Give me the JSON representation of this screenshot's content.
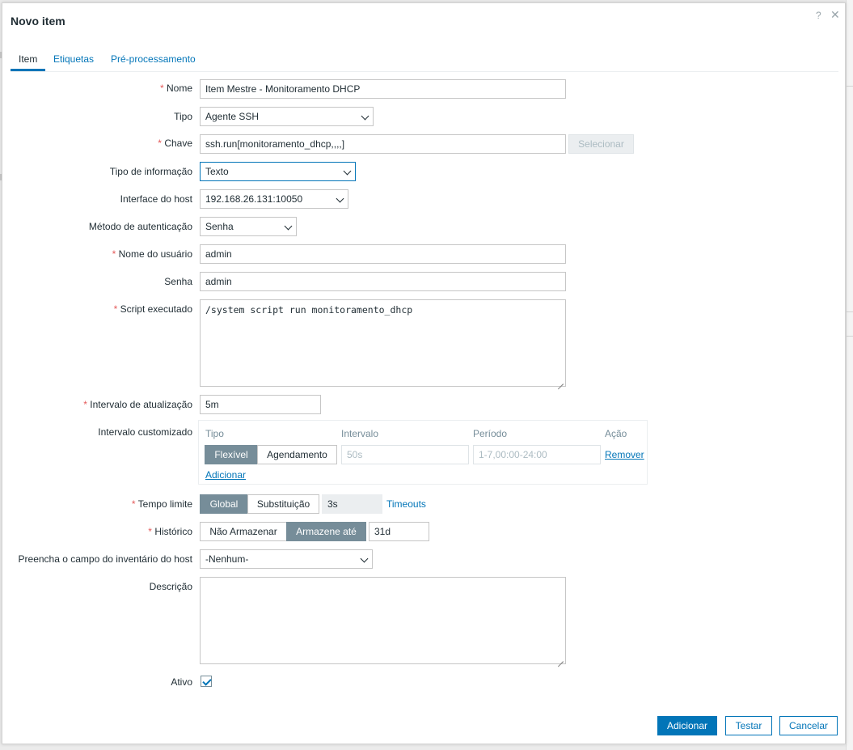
{
  "dialog": {
    "title": "Novo item",
    "help_icon": "?",
    "close_icon": "✕"
  },
  "tabs": [
    {
      "label": "Item",
      "active": true
    },
    {
      "label": "Etiquetas",
      "active": false
    },
    {
      "label": "Pré-processamento",
      "active": false
    }
  ],
  "required_mark": "*",
  "form": {
    "name": {
      "label": "Nome",
      "value": "Item Mestre - Monitoramento DHCP"
    },
    "type": {
      "label": "Tipo",
      "value": "Agente SSH"
    },
    "key": {
      "label": "Chave",
      "value": "ssh.run[monitoramento_dhcp,,,,]",
      "select_button": "Selecionar"
    },
    "info_type": {
      "label": "Tipo de informação",
      "value": "Texto"
    },
    "host_interface": {
      "label": "Interface do host",
      "value": "192.168.26.131:10050"
    },
    "auth_method": {
      "label": "Método de autenticação",
      "value": "Senha"
    },
    "username": {
      "label": "Nome do usuário",
      "value": "admin"
    },
    "password": {
      "label": "Senha",
      "value": "admin"
    },
    "script": {
      "label": "Script executado",
      "value": "/system script run monitoramento_dhcp"
    },
    "update_interval": {
      "label": "Intervalo de atualização",
      "value": "5m"
    },
    "custom_intervals": {
      "label": "Intervalo customizado",
      "columns": [
        "Tipo",
        "Intervalo",
        "Período",
        "Ação"
      ],
      "row": {
        "type_options": [
          "Flexível",
          "Agendamento"
        ],
        "selected_type": "Flexível",
        "interval_placeholder": "50s",
        "period_placeholder": "1-7,00:00-24:00",
        "remove_label": "Remover"
      },
      "add_label": "Adicionar"
    },
    "timeout": {
      "label": "Tempo limite",
      "options": [
        "Global",
        "Substituição"
      ],
      "selected": "Global",
      "value": "3s",
      "link": "Timeouts"
    },
    "history": {
      "label": "Histórico",
      "options": [
        "Não Armazenar",
        "Armazene até"
      ],
      "selected": "Armazene até",
      "value": "31d"
    },
    "inventory": {
      "label": "Preencha o campo do inventário do host",
      "value": "-Nenhum-"
    },
    "description": {
      "label": "Descrição",
      "value": ""
    },
    "enabled": {
      "label": "Ativo",
      "checked": true
    }
  },
  "footer": {
    "add": "Adicionar",
    "test": "Testar",
    "cancel": "Cancelar"
  },
  "colors": {
    "accent": "#0275b8",
    "required": "#e45959",
    "segment_active": "#768d99"
  }
}
